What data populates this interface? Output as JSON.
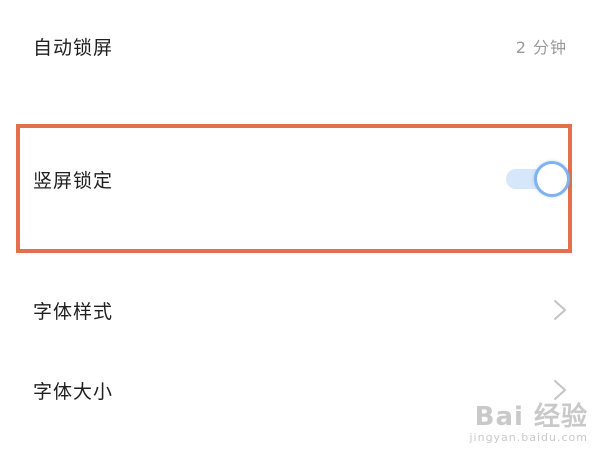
{
  "settings": {
    "auto_lock": {
      "label": "自动锁屏",
      "value": "2 分钟"
    },
    "rotation_lock": {
      "label": "竖屏锁定",
      "enabled": true
    },
    "font_style": {
      "label": "字体样式"
    },
    "font_size": {
      "label": "字体大小"
    }
  },
  "icons": {
    "font_style_chevron": "chevron-right-icon",
    "font_size_chevron": "chevron-right-icon"
  },
  "colors": {
    "highlight_border": "#e2704a",
    "toggle_track": "#d6e6fb",
    "toggle_knob_border": "#7fb2ee",
    "label_text": "#1f1f1f",
    "value_text": "#9a9a9a",
    "chevron": "#c4c4c4"
  },
  "watermark": {
    "main": "Bai 经验",
    "sub": "jingyan.baidu.com"
  }
}
